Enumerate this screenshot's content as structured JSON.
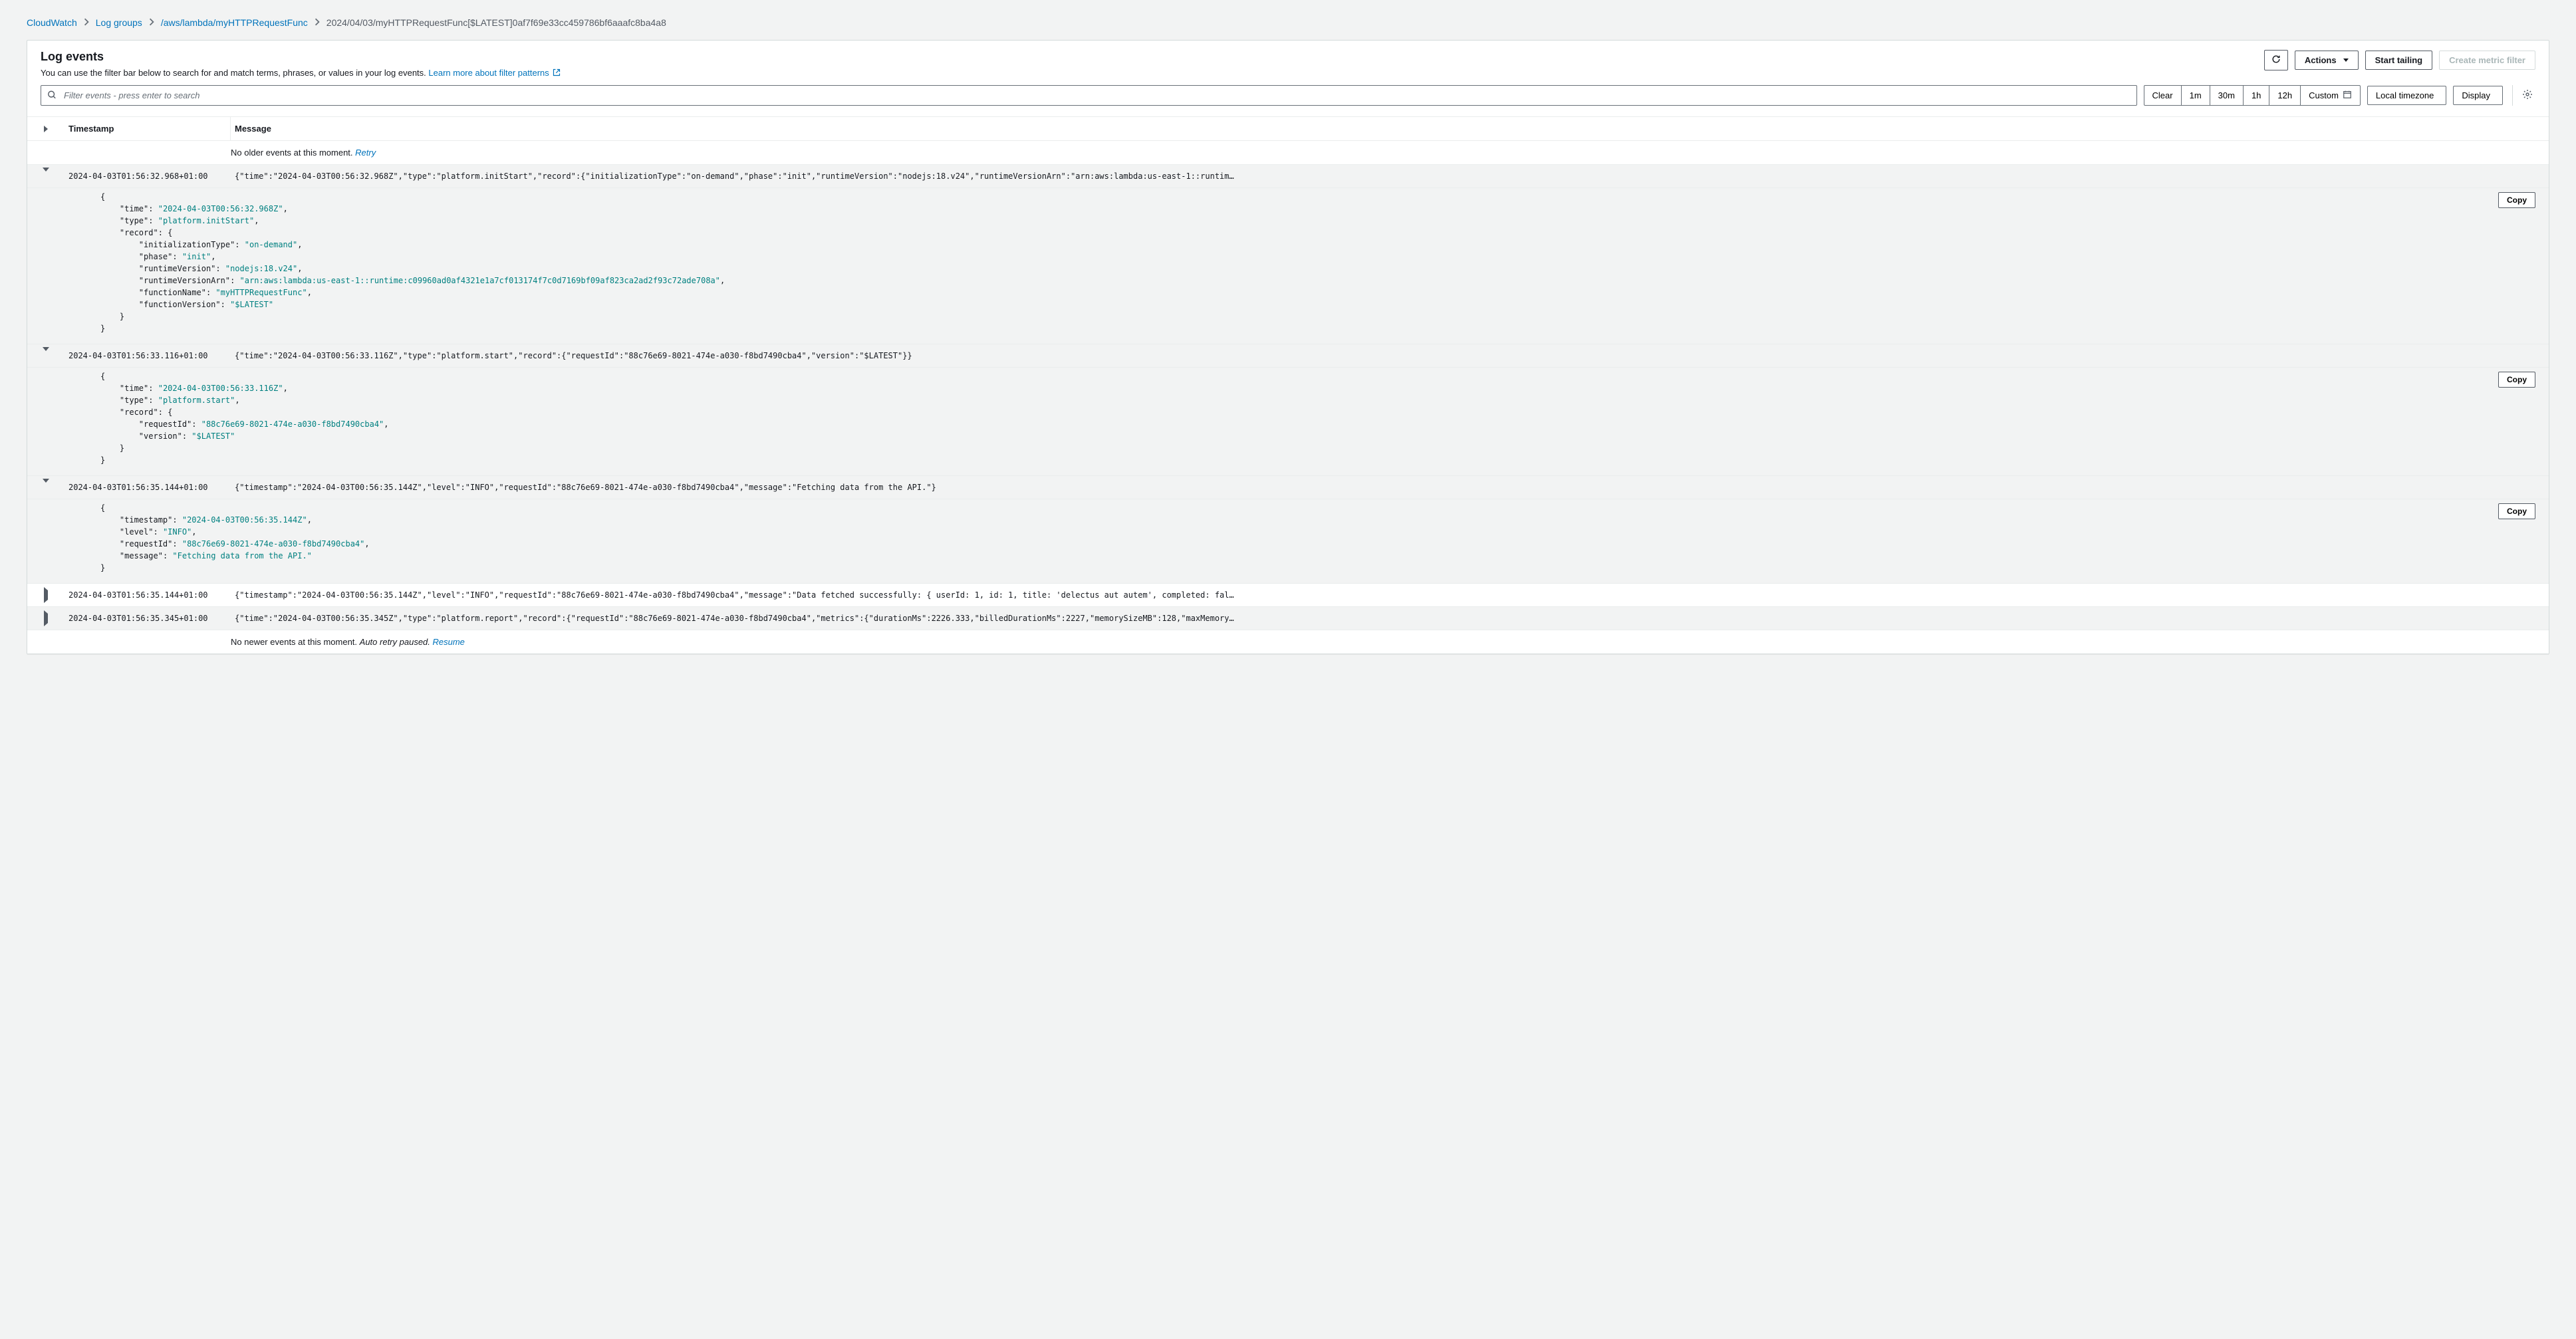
{
  "breadcrumbs": {
    "items": [
      "CloudWatch",
      "Log groups",
      "/aws/lambda/myHTTPRequestFunc"
    ],
    "current": "2024/04/03/myHTTPRequestFunc[$LATEST]0af7f69e33cc459786bf6aaafc8ba4a8"
  },
  "header": {
    "title": "Log events",
    "subtitle_prefix": "You can use the filter bar below to search for and match terms, phrases, or values in your log events. ",
    "subtitle_link": "Learn more about filter patterns",
    "refresh_btn": "Refresh",
    "actions_btn": "Actions",
    "start_tailing_btn": "Start tailing",
    "create_metric_btn": "Create metric filter"
  },
  "toolbar": {
    "filter_placeholder": "Filter events - press enter to search",
    "clear": "Clear",
    "r1m": "1m",
    "r30m": "30m",
    "r1h": "1h",
    "r12h": "12h",
    "custom": "Custom",
    "timezone": "Local timezone",
    "display": "Display"
  },
  "table": {
    "col_timestamp": "Timestamp",
    "col_message": "Message",
    "no_older": "No older events at this moment. ",
    "retry": "Retry",
    "no_newer_prefix": "No newer events at this moment. ",
    "no_newer_italic": "Auto retry paused. ",
    "resume": "Resume",
    "copy": "Copy"
  },
  "events": [
    {
      "expanded": true,
      "timestamp": "2024-04-03T01:56:32.968+01:00",
      "summary": "{\"time\":\"2024-04-03T00:56:32.968Z\",\"type\":\"platform.initStart\",\"record\":{\"initializationType\":\"on-demand\",\"phase\":\"init\",\"runtimeVersion\":\"nodejs:18.v24\",\"runtimeVersionArn\":\"arn:aws:lambda:us-east-1::runtim…",
      "detail": {
        "time": "2024-04-03T00:56:32.968Z",
        "type": "platform.initStart",
        "record": {
          "initializationType": "on-demand",
          "phase": "init",
          "runtimeVersion": "nodejs:18.v24",
          "runtimeVersionArn": "arn:aws:lambda:us-east-1::runtime:c09960ad0af4321e1a7cf013174f7c0d7169bf09af823ca2ad2f93c72ade708a",
          "functionName": "myHTTPRequestFunc",
          "functionVersion": "$LATEST"
        }
      }
    },
    {
      "expanded": true,
      "timestamp": "2024-04-03T01:56:33.116+01:00",
      "summary": "{\"time\":\"2024-04-03T00:56:33.116Z\",\"type\":\"platform.start\",\"record\":{\"requestId\":\"88c76e69-8021-474e-a030-f8bd7490cba4\",\"version\":\"$LATEST\"}}",
      "detail": {
        "time": "2024-04-03T00:56:33.116Z",
        "type": "platform.start",
        "record": {
          "requestId": "88c76e69-8021-474e-a030-f8bd7490cba4",
          "version": "$LATEST"
        }
      }
    },
    {
      "expanded": true,
      "timestamp": "2024-04-03T01:56:35.144+01:00",
      "summary": "{\"timestamp\":\"2024-04-03T00:56:35.144Z\",\"level\":\"INFO\",\"requestId\":\"88c76e69-8021-474e-a030-f8bd7490cba4\",\"message\":\"Fetching data from the API.\"}",
      "detail": {
        "timestamp": "2024-04-03T00:56:35.144Z",
        "level": "INFO",
        "requestId": "88c76e69-8021-474e-a030-f8bd7490cba4",
        "message": "Fetching data from the API."
      }
    },
    {
      "expanded": false,
      "timestamp": "2024-04-03T01:56:35.144+01:00",
      "summary": "{\"timestamp\":\"2024-04-03T00:56:35.144Z\",\"level\":\"INFO\",\"requestId\":\"88c76e69-8021-474e-a030-f8bd7490cba4\",\"message\":\"Data fetched successfully: { userId: 1, id: 1, title: 'delectus aut autem', completed: fal…"
    },
    {
      "expanded": false,
      "timestamp": "2024-04-03T01:56:35.345+01:00",
      "summary": "{\"time\":\"2024-04-03T00:56:35.345Z\",\"type\":\"platform.report\",\"record\":{\"requestId\":\"88c76e69-8021-474e-a030-f8bd7490cba4\",\"metrics\":{\"durationMs\":2226.333,\"billedDurationMs\":2227,\"memorySizeMB\":128,\"maxMemory…"
    }
  ]
}
